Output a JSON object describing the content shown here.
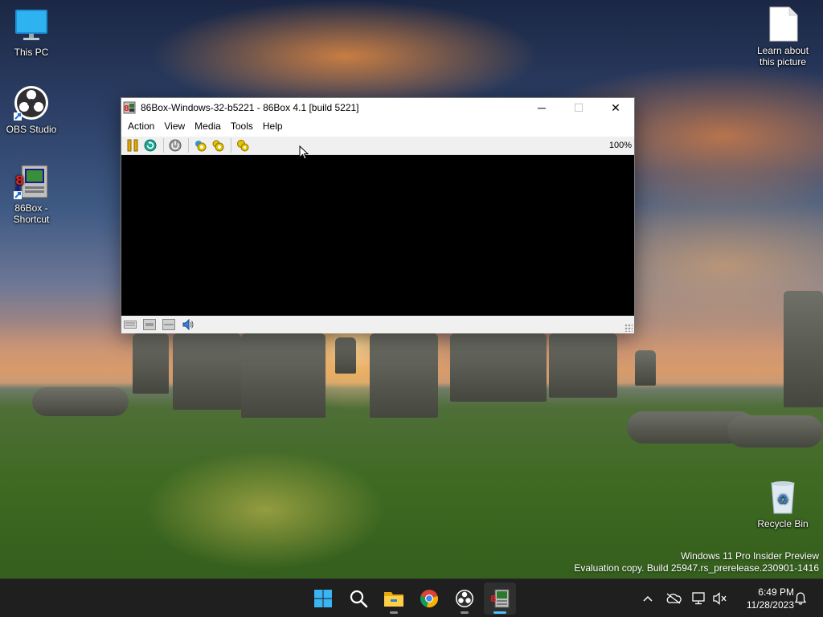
{
  "desktop": {
    "icons": [
      {
        "label": "This PC"
      },
      {
        "label": "OBS Studio"
      },
      {
        "label": "86Box -\nShortcut"
      },
      {
        "label": "Learn about\nthis picture"
      },
      {
        "label": "Recycle Bin"
      }
    ],
    "watermark": {
      "line1": "Windows 11 Pro Insider Preview",
      "line2": "Evaluation copy. Build 25947.rs_prerelease.230901-1416"
    }
  },
  "window": {
    "title": "86Box-Windows-32-b5221 - 86Box 4.1 [build 5221]",
    "controls": {
      "minimize": "─",
      "maximize": "☐",
      "close": "✕"
    },
    "menu": [
      "Action",
      "View",
      "Media",
      "Tools",
      "Help"
    ],
    "toolbar": {
      "buttons": [
        "pause-icon",
        "hard-reset-icon",
        "ctrl-alt-del-icon",
        "ctrl-alt-esc-icon",
        "settings-icon",
        "acpi-shutdown-icon"
      ],
      "zoom": "100%"
    },
    "statusbar": [
      "keyboard-icon",
      "floppy-drive-icon",
      "cdrom-drive-icon",
      "sound-icon"
    ]
  },
  "taskbar": {
    "apps": [
      "start-icon",
      "search-icon",
      "file-explorer-icon",
      "chrome-icon",
      "obs-icon",
      "86box-icon"
    ],
    "clock": {
      "time": "6:49 PM",
      "date": "11/28/2023"
    }
  },
  "colors": {
    "taskbar_bg": "#1f1f1f",
    "accent": "#4cc2ff",
    "window_bg": "#ffffff"
  }
}
